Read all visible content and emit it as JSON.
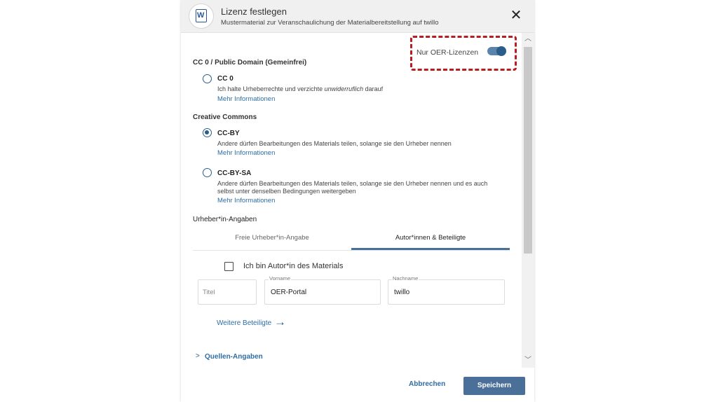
{
  "dialog": {
    "title": "Lizenz festlegen",
    "subtitle": "Mustermaterial zur Veranschaulichung der Materialbereitstellung auf twillo",
    "close_label": "✕"
  },
  "toggle": {
    "label": "Nur OER-Lizenzen",
    "on": true
  },
  "sections": {
    "cc0": "CC 0 / Public Domain (Gemeinfrei)",
    "cc": "Creative Commons",
    "author": "Urheber*in-Angaben"
  },
  "options": [
    {
      "title": "CC 0",
      "desc_before": "Ich halte Urheberrechte und verzichte ",
      "desc_em": "unwiderruflich",
      "desc_after": " darauf",
      "more": "Mehr Informationen",
      "checked": false
    },
    {
      "title": "CC-BY",
      "desc": "Andere dürfen Bearbeitungen des Materials teilen, solange sie den Urheber nennen",
      "more": "Mehr Informationen",
      "checked": true
    },
    {
      "title": "CC-BY-SA",
      "desc": "Andere dürfen Bearbeitungen des Materials teilen, solange sie den Urheber nennen und es auch selbst unter denselben Bedingungen weitergeben",
      "more": "Mehr Informationen",
      "checked": false
    }
  ],
  "tabs": [
    {
      "label": "Freie Urheber*in-Angabe",
      "active": false
    },
    {
      "label": "Autor*innen & Beteiligte",
      "active": true
    }
  ],
  "author_checkbox": {
    "label": "Ich bin Autor*in des Materials",
    "checked": false
  },
  "fields": {
    "title_placeholder": "Titel",
    "firstname_label": "Vorname",
    "firstname_value": "OER-Portal",
    "lastname_label": "Nachname",
    "lastname_value": "twillo"
  },
  "more_participants": "Weitere Beteiligte",
  "sources_label": "Quellen-Angaben",
  "footer": {
    "cancel": "Abbrechen",
    "save": "Speichern"
  },
  "colors": {
    "accent": "#4a6f99",
    "link": "#2e6da4",
    "highlight": "#b91d24"
  },
  "icons": {
    "doc": "word-document-icon",
    "close": "close-icon",
    "arrow": "arrow-right-icon",
    "chevron": "chevron-right-icon"
  }
}
